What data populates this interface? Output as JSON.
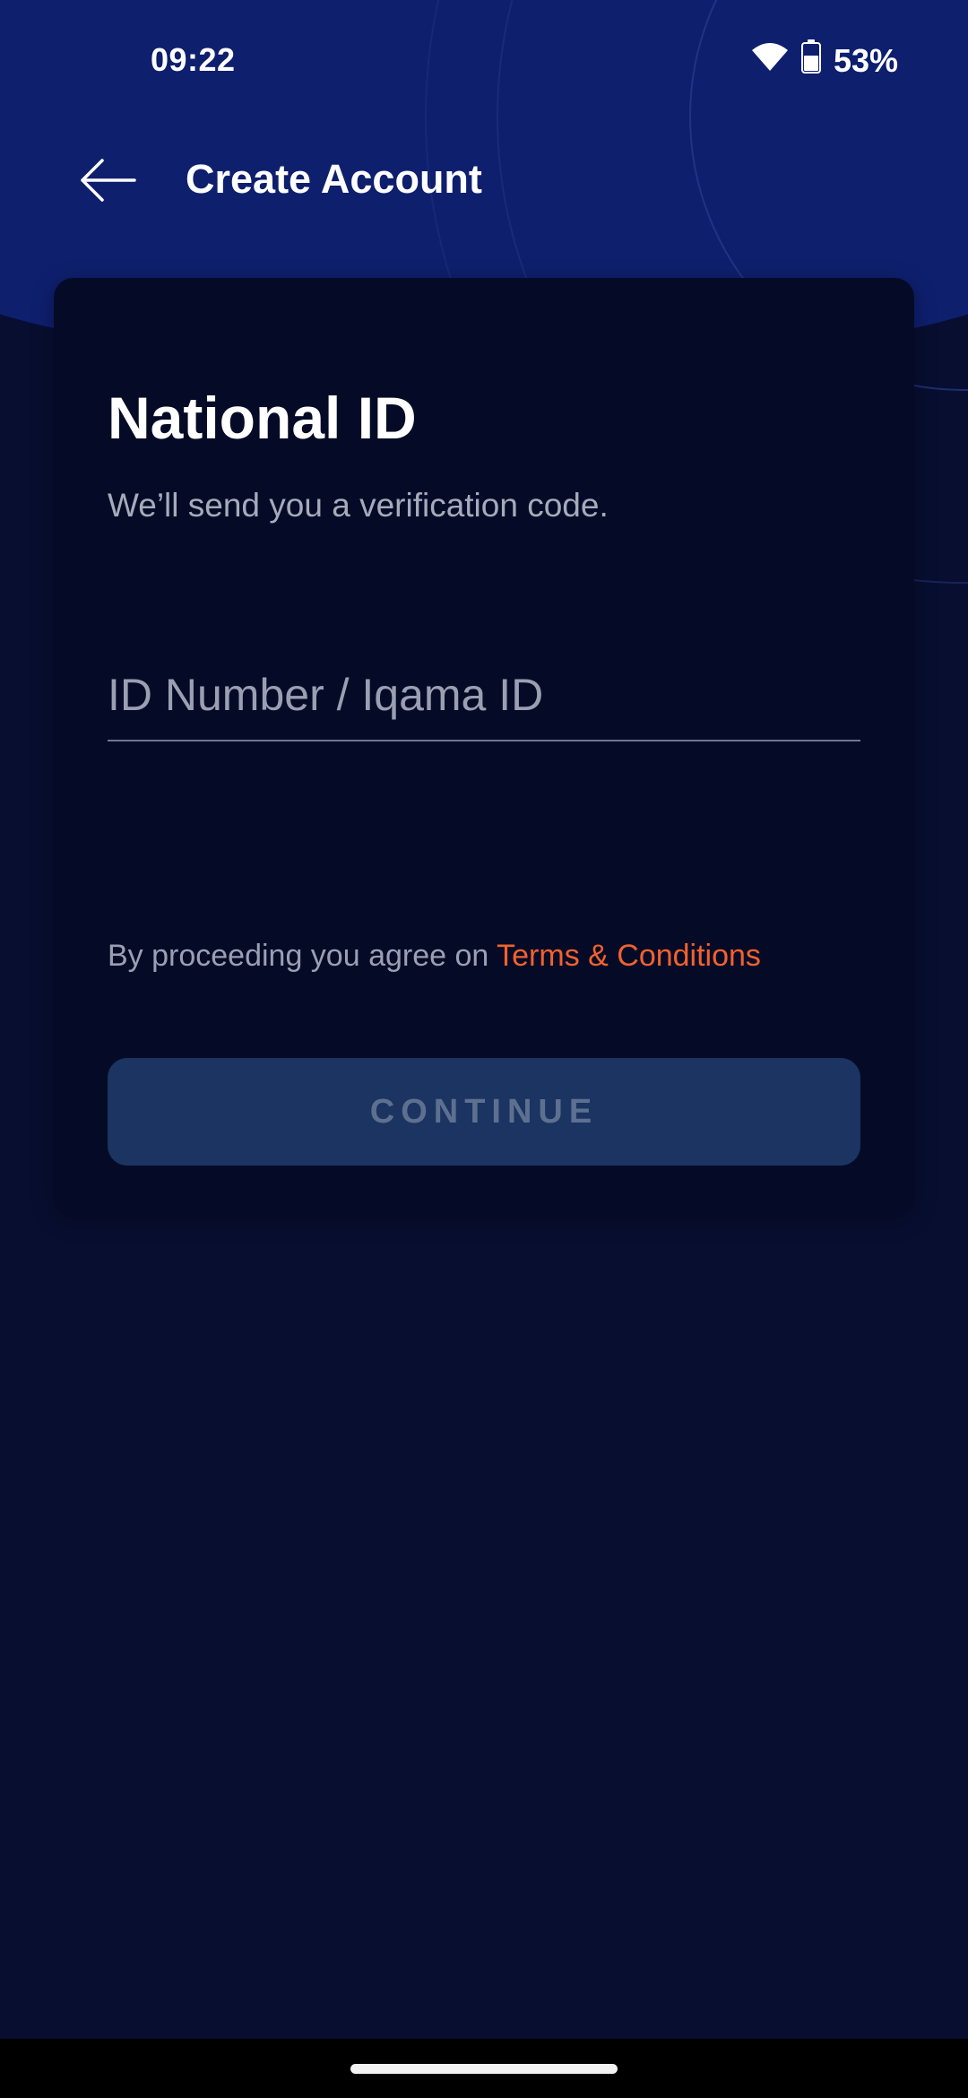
{
  "status_bar": {
    "time": "09:22",
    "battery_percent": "53%",
    "icons": [
      "wifi-icon",
      "battery-icon"
    ]
  },
  "app_bar": {
    "back_icon": "arrow-left-icon",
    "title": "Create Account"
  },
  "card": {
    "title": "National ID",
    "subtitle": "We’ll send you a verification code.",
    "id_input": {
      "placeholder": "ID Number / Iqama ID",
      "value": ""
    },
    "terms": {
      "prefix": "By proceeding you agree on ",
      "link": "Terms & Conditions"
    },
    "continue_label": "CONTINUE"
  },
  "colors": {
    "background": "#070e30",
    "header": "#0e1f6e",
    "card": "#050b27",
    "accent_link": "#f2612e",
    "button_disabled": "#1b3461"
  }
}
